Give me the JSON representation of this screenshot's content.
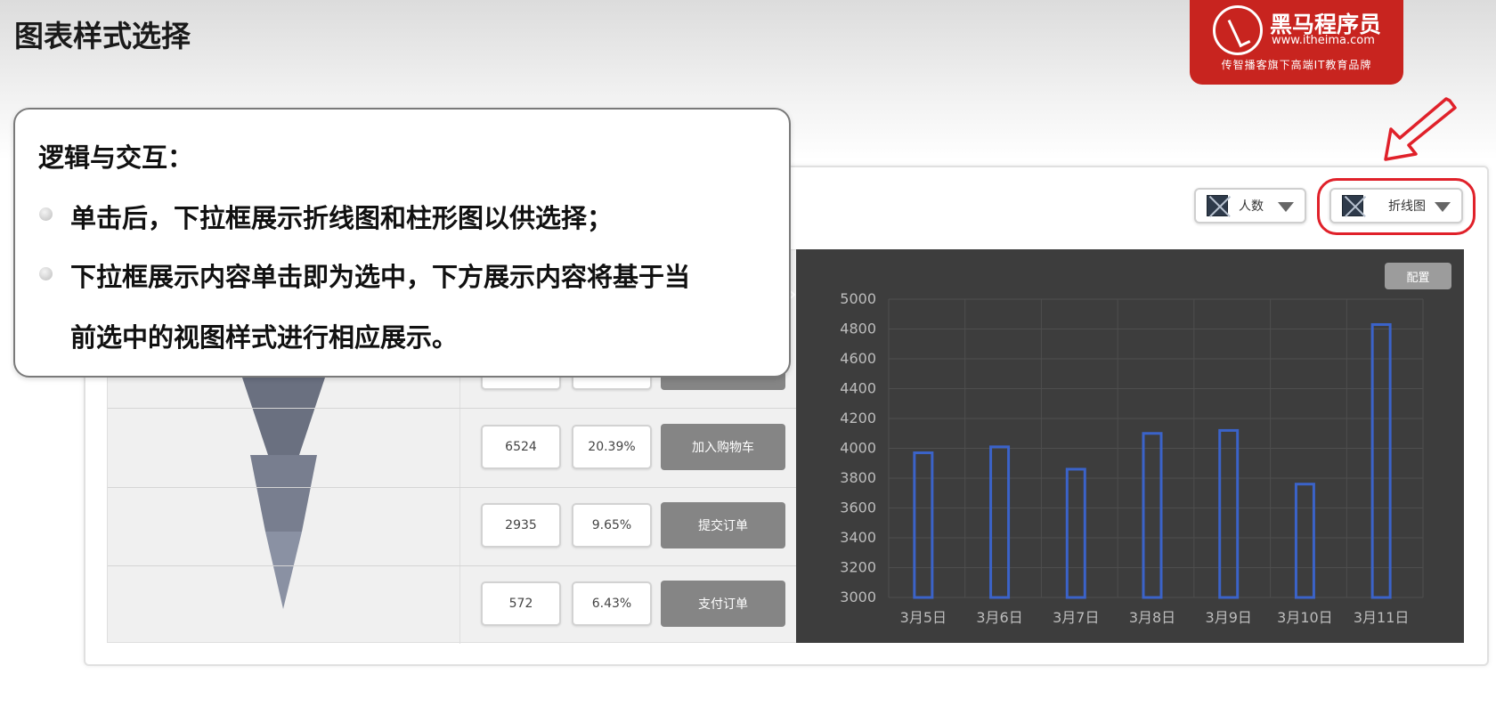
{
  "slide": {
    "title": "图表样式选择"
  },
  "logo": {
    "brand": "黑马程序员",
    "url": "www.itheima.com",
    "slogan": "传智播客旗下高端IT教育品牌"
  },
  "callout": {
    "heading": "逻辑与交互：",
    "lines": [
      "单击后，下拉框展示折线图和柱形图以供选择；",
      "下拉框展示内容单击即为选中，下方展示内容将基于当",
      "前选中的视图样式进行相应展示。"
    ]
  },
  "selectors": {
    "metric_label": "人数",
    "chart_type_label": "折线图"
  },
  "funnel": {
    "rows": [
      {
        "count": "6524",
        "rate": "20.39%",
        "stage": "加入购物车"
      },
      {
        "count": "2935",
        "rate": "9.65%",
        "stage": "提交订单"
      },
      {
        "count": "572",
        "rate": "6.43%",
        "stage": "支付订单"
      }
    ]
  },
  "chart": {
    "config_label": "配置"
  },
  "chart_data": {
    "type": "bar",
    "categories": [
      "3月5日",
      "3月6日",
      "3月7日",
      "3月8日",
      "3月9日",
      "3月10日",
      "3月11日"
    ],
    "values": [
      3970,
      4010,
      3860,
      4100,
      4120,
      3760,
      4830
    ],
    "ylim": [
      3000,
      5000
    ],
    "yticks": [
      3000,
      3200,
      3400,
      3600,
      3800,
      4000,
      4200,
      4400,
      4600,
      4800,
      5000
    ],
    "grid": true,
    "colors": {
      "bar_outline": "#3b63c9",
      "background": "#3d3d3d",
      "grid": "#4e4e4e",
      "tick": "#bdbdbd"
    }
  }
}
